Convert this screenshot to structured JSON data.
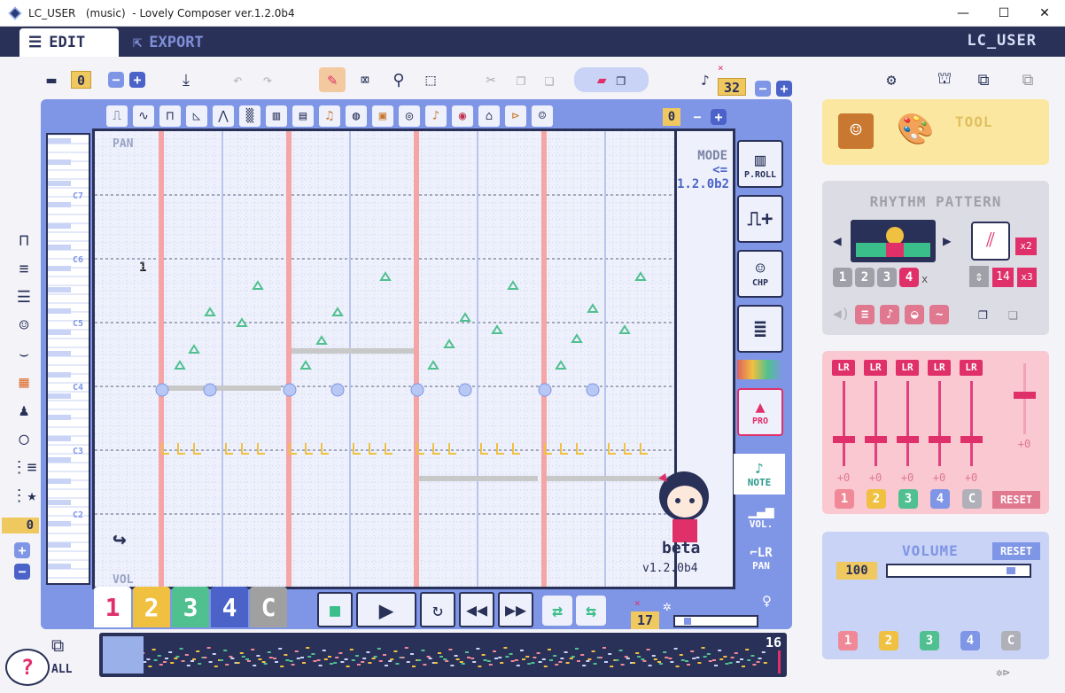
{
  "window": {
    "title": "LC_USER   (music)  - Lovely Composer ver.1.2.0b4",
    "minimize": "—",
    "maximize": "☐",
    "close": "✕"
  },
  "menubar": {
    "edit_label": "EDIT",
    "export_label": "EXPORT",
    "user_label": "LC_USER"
  },
  "toolbar": {
    "slot_number": "0",
    "minus": "−",
    "plus": "+",
    "speed_value": "32",
    "speed_minus": "−",
    "speed_plus": "+"
  },
  "instrument_bar": {
    "instrument_number": "0",
    "minus": "−",
    "plus": "+"
  },
  "left_tools": {
    "counter": "0",
    "plus": "+",
    "minus": "−"
  },
  "grid": {
    "pan_label": "PAN",
    "vol_label": "VOL",
    "mode_label": "MODE",
    "mode_version": "<= 1.2.0b2",
    "marker_text": "1",
    "key_labels": [
      "C7",
      "C6",
      "C5",
      "C4",
      "C3",
      "C2"
    ],
    "beta_label": "beta",
    "version_label": "v1.2.0b4"
  },
  "right_rail": {
    "piano_roll": "P.ROLL",
    "chip_label": "CHP",
    "pro_label": "PRO",
    "note_label": "NOTE",
    "vol_label": "VOL.",
    "pan_label": "PAN"
  },
  "channels": [
    "1",
    "2",
    "3",
    "4",
    "C"
  ],
  "transport": {
    "tempo_value": "17",
    "mute_mark": "×"
  },
  "timeline": {
    "page_count": "16",
    "all_label": "ALL"
  },
  "tool_panel": {
    "title": "TOOL"
  },
  "rhythm_panel": {
    "title": "RHYTHM PATTERN",
    "numbers": [
      "1",
      "2",
      "3",
      "4"
    ],
    "x_mark": "x",
    "multiplier_a": "x2",
    "multiplier_b": "x3",
    "value": "14",
    "prev": "◀",
    "next": "▶"
  },
  "mixer_panel": {
    "lr_labels": [
      "LR",
      "LR",
      "LR",
      "LR",
      "LR"
    ],
    "values": [
      "+0",
      "+0",
      "+0",
      "+0",
      "+0"
    ],
    "master_value": "+0",
    "channel_chips": [
      "1",
      "2",
      "3",
      "4",
      "C"
    ],
    "reset_label": "RESET"
  },
  "volume_panel": {
    "title": "VOLUME",
    "reset_label": "RESET",
    "value": "100",
    "channel_chips": [
      "1",
      "2",
      "3",
      "4",
      "C"
    ]
  },
  "colors": {
    "navy": "#2a3158",
    "periwinkle": "#7f95e6",
    "light": "#eef1fb",
    "pink": "#e0306a",
    "ch1": "#ffffff",
    "ch2": "#f0c040",
    "ch3": "#50c090",
    "ch4": "#4b63c8",
    "chC": "#a0a0a0"
  }
}
